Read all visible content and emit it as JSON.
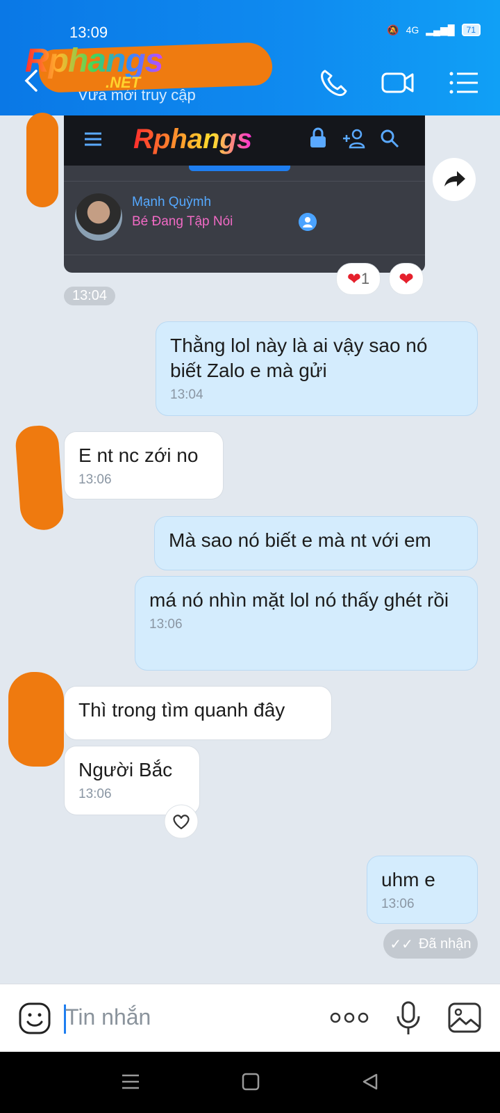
{
  "status_bar": {
    "time": "13:09",
    "network": "4G",
    "battery": "71"
  },
  "header": {
    "contact_status": "Vừa mới truy cập",
    "watermark_logo": "Rphangs",
    "watermark_sub": ".NET"
  },
  "shared_card": {
    "logo": "Rphangs",
    "user_name": "Mạnh Quỳmh",
    "user_rank": "Bé Đang Tập Nói"
  },
  "reactions": {
    "heart_count": "1"
  },
  "messages": [
    {
      "time_pill": "13:04"
    },
    {
      "text": "Thằng lol này là ai vậy sao nó biết Zalo e mà gửi",
      "time": "13:04"
    },
    {
      "text": "E nt nc zới no",
      "time": "13:06"
    },
    {
      "text": "Mà sao nó biết e mà nt với em"
    },
    {
      "text": "má nó nhìn mặt lol nó thấy ghét rồi",
      "time": "13:06"
    },
    {
      "text": "Thì trong tìm quanh đây"
    },
    {
      "text": "Người Bắc",
      "time": "13:06"
    },
    {
      "text": "uhm e",
      "time": "13:06"
    }
  ],
  "delivery_status": "Đã nhận",
  "composer": {
    "placeholder": "Tin nhắn"
  },
  "colors": {
    "header": "#0a78e6",
    "outgoing_bubble": "#d4ecfd",
    "incoming_bubble": "#ffffff",
    "background": "#e2e8ef"
  }
}
